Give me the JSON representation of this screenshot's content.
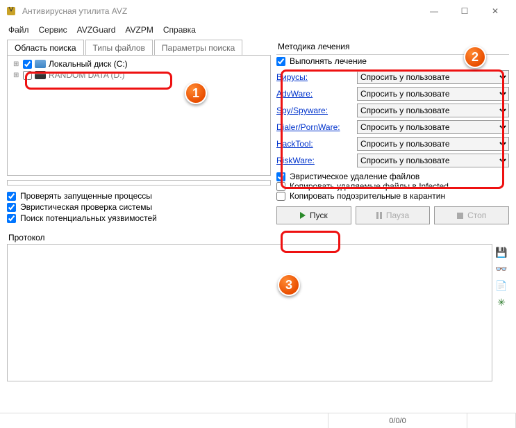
{
  "window": {
    "title": "Антивирусная утилита AVZ",
    "min": "—",
    "max": "☐",
    "close": "✕"
  },
  "menu": {
    "file": "Файл",
    "service": "Сервис",
    "avzguard": "AVZGuard",
    "avzpm": "AVZPM",
    "help": "Справка"
  },
  "tabs_left": {
    "t1": "Область поиска",
    "t2": "Типы файлов",
    "t3": "Параметры поиска"
  },
  "tree": {
    "item1": "Локальный диск (C:)",
    "item2": "RANDOM DATA (D:)"
  },
  "left_checks": {
    "c1": "Проверять запущенные процессы",
    "c2": "Эвристическая проверка системы",
    "c3": "Поиск потенциальных уязвимостей"
  },
  "right": {
    "heading": "Методика лечения",
    "perform": "Выполнять лечение",
    "rows": {
      "r1": "Вирусы:",
      "r2": "AdvWare:",
      "r3": "Spy/Spyware:",
      "r4": "Dialer/PornWare:",
      "r5": "HackTool:",
      "r6": "RiskWare:"
    },
    "select_val": "Спросить у пользовате",
    "heur": "Эвристическое удаление файлов",
    "copy_inf": "Копировать удаляемые файлы в Infected",
    "copy_quar": "Копировать подозрительные в карантин"
  },
  "buttons": {
    "start": "Пуск",
    "pause": "Пауза",
    "stop": "Стоп"
  },
  "protocol": {
    "label": "Протокол"
  },
  "status": {
    "counts": "0/0/0"
  },
  "badges": {
    "b1": "1",
    "b2": "2",
    "b3": "3"
  }
}
